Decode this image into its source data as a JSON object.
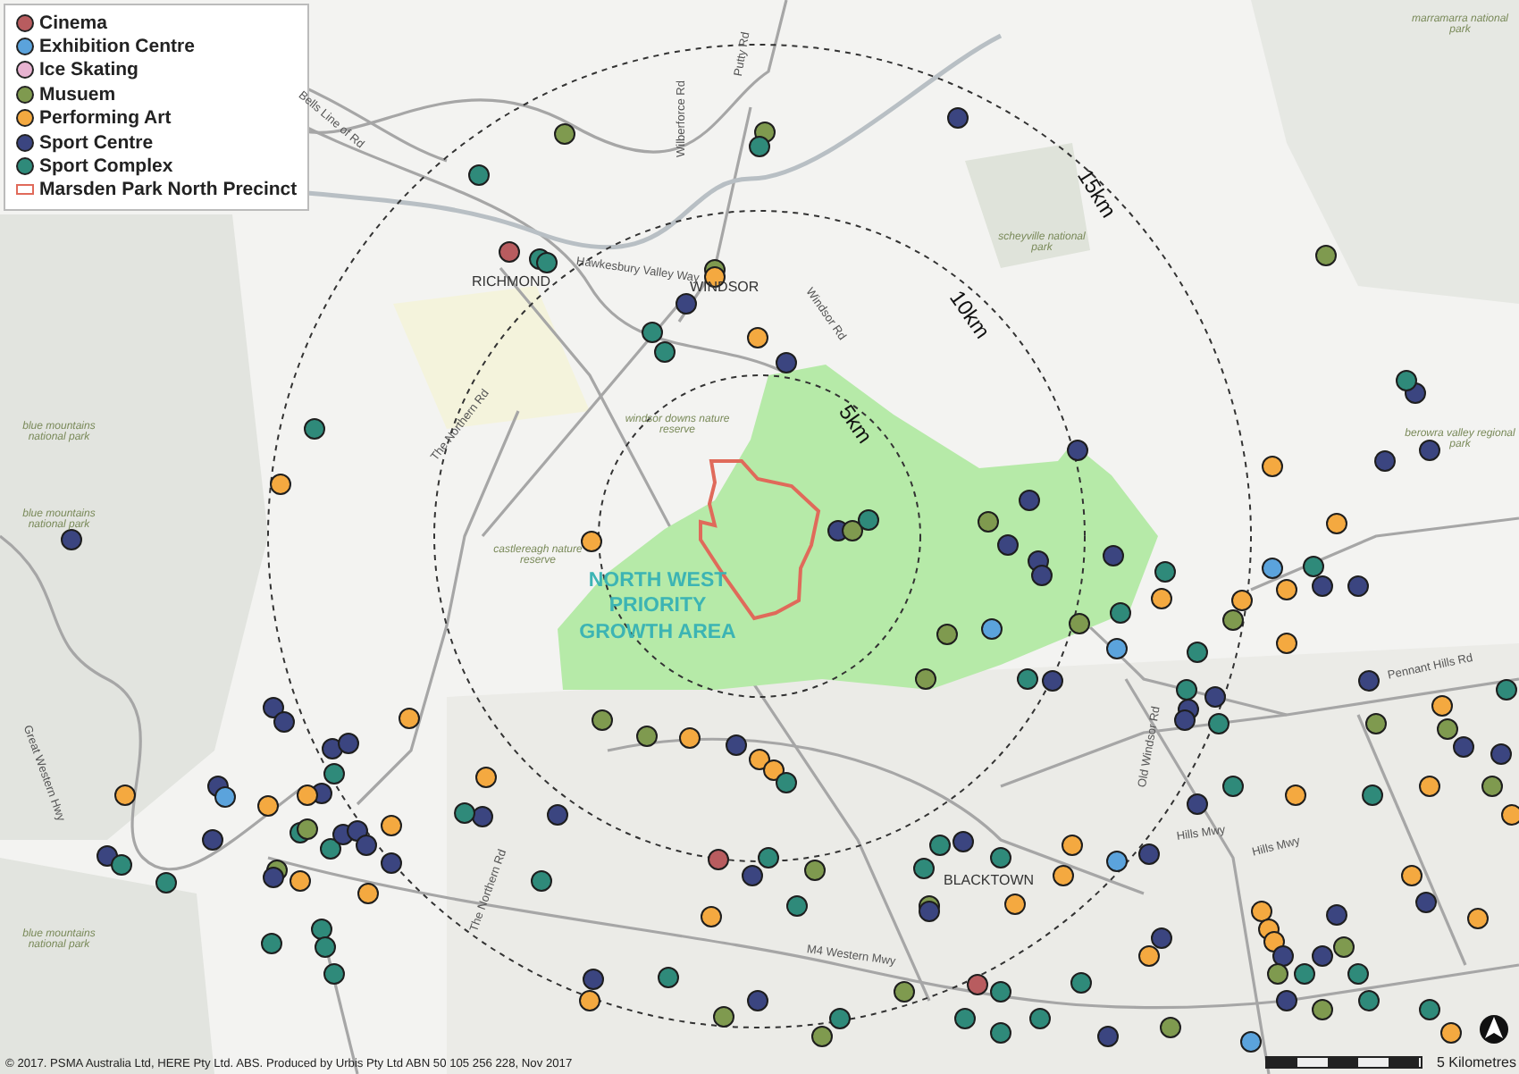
{
  "legend": [
    {
      "label": "Cinema",
      "kind": "dot",
      "color": "#b85c5f"
    },
    {
      "label": "Exhibition Centre",
      "kind": "dot",
      "color": "#5ba3dc"
    },
    {
      "label": "Ice Skating",
      "kind": "dot",
      "color": "#e8b3d1"
    },
    {
      "label": "Musuem",
      "kind": "dot",
      "color": "#7f9a4f"
    },
    {
      "label": "Performing Art",
      "kind": "dot",
      "color": "#f4a940"
    },
    {
      "label": "Sport Centre",
      "kind": "dot",
      "color": "#3b4580"
    },
    {
      "label": "Sport Complex",
      "kind": "dot",
      "color": "#2f8a7a"
    },
    {
      "label": "Marsden Park North Precinct",
      "kind": "outline",
      "color": "#e06a5a"
    }
  ],
  "rings": [
    {
      "label": "5km"
    },
    {
      "label": "10km"
    },
    {
      "label": "15km"
    }
  ],
  "growth_area": {
    "label": "NORTH WEST PRIORITY GROWTH AREA"
  },
  "places": [
    {
      "label": "RICHMOND"
    },
    {
      "label": "WINDSOR"
    },
    {
      "label": "BLACKTOWN"
    }
  ],
  "roads": [
    {
      "label": "Hawkesbury Valley Way"
    },
    {
      "label": "Wilberforce Rd"
    },
    {
      "label": "Putty Rd"
    },
    {
      "label": "Bells Line of Rd"
    },
    {
      "label": "Windsor Rd"
    },
    {
      "label": "The Northern Rd"
    },
    {
      "label": "The Northern Rd"
    },
    {
      "label": "Great Western Hwy"
    },
    {
      "label": "Old Windsor Rd"
    },
    {
      "label": "Hills Mwy"
    },
    {
      "label": "Hills Mwy"
    },
    {
      "label": "Pennant Hills Rd"
    },
    {
      "label": "M4 Western Mwy"
    }
  ],
  "parks": [
    {
      "label": "blue mountains national park"
    },
    {
      "label": "blue mountains national park"
    },
    {
      "label": "blue mountains national park"
    },
    {
      "label": "windsor downs nature reserve"
    },
    {
      "label": "castlereagh nature reserve"
    },
    {
      "label": "scheyville national park"
    },
    {
      "label": "marramarra national park"
    },
    {
      "label": "berowra valley regional park"
    }
  ],
  "attribution": "© 2017. PSMA Australia Ltd, HERE Pty Ltd. ABS. Produced by Urbis Pty Ltd ABN 50 105 256 228, Nov 2017",
  "scale_bar": {
    "label": "5 Kilometres"
  }
}
